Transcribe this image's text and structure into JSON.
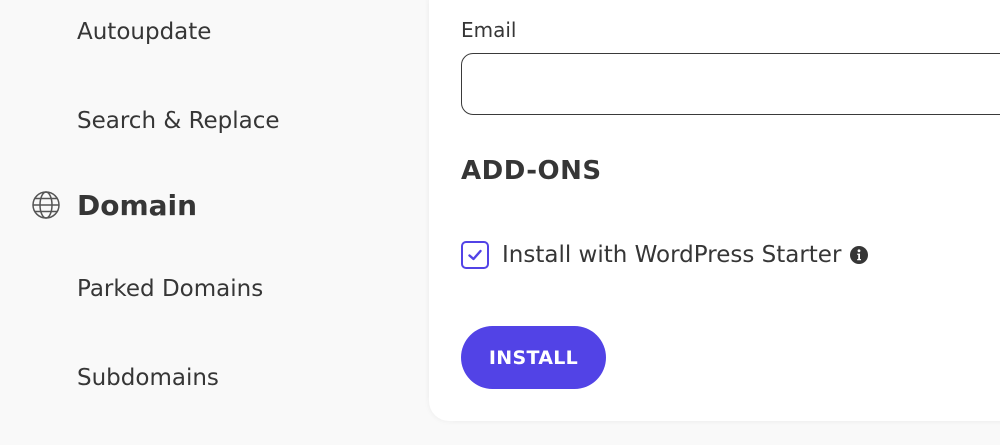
{
  "sidebar": {
    "items": [
      {
        "label": "Autoupdate"
      },
      {
        "label": "Search & Replace"
      }
    ],
    "section": {
      "label": "Domain",
      "icon": "globe-icon"
    },
    "subitems": [
      {
        "label": "Parked Domains"
      },
      {
        "label": "Subdomains"
      }
    ]
  },
  "form": {
    "email_label": "Email",
    "email_value": "",
    "email_placeholder": "",
    "addons_heading": "ADD-ONS",
    "addon": {
      "label": "Install with WordPress Starter",
      "checked": true,
      "info_icon": "info-icon"
    },
    "install_label": "INSTALL"
  },
  "colors": {
    "accent": "#5243e6",
    "text": "#363636",
    "background": "#f9f9f9",
    "panel": "#ffffff"
  }
}
